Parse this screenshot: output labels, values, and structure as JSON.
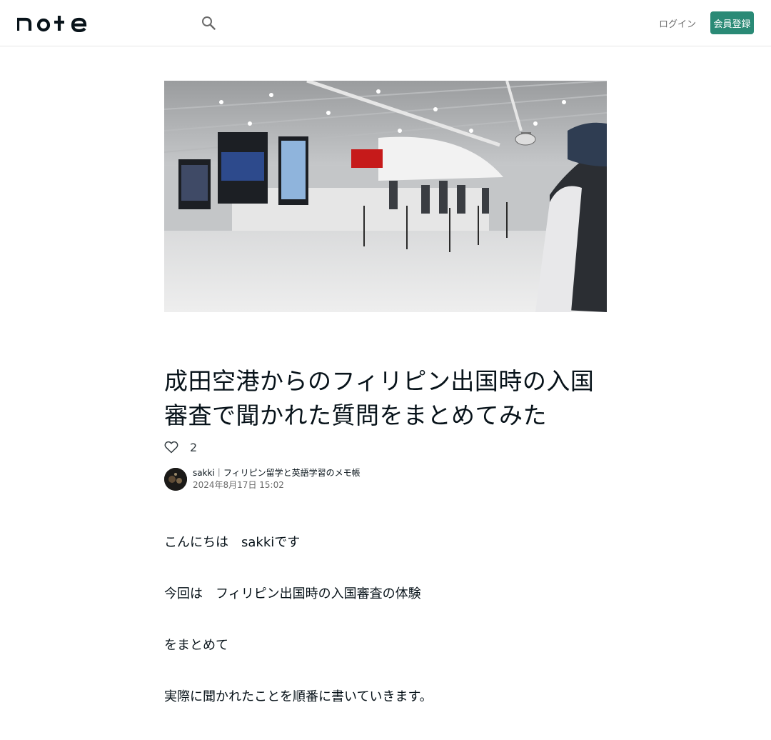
{
  "header": {
    "logo_text": "note",
    "search_icon": "search-icon",
    "login_label": "ログイン",
    "signup_label": "会員登録",
    "brand_color": "#2a8a76"
  },
  "hero": {
    "description_icon": "airport-terminal-photo"
  },
  "article": {
    "title": "成田空港からのフィリピン出国時の入国審査で聞かれた質問をまとめてみた",
    "like_count": "2",
    "like_icon": "heart-outline-icon",
    "author_name": "sakki｜フィリピン留学と英語学習のメモ帳",
    "date": "2024年8月17日 15:02",
    "paragraphs": [
      "こんにちは　sakkiです",
      "今回は　フィリピン出国時の入国審査の体験",
      "をまとめて",
      "実際に聞かれたことを順番に書いていきます。"
    ]
  }
}
